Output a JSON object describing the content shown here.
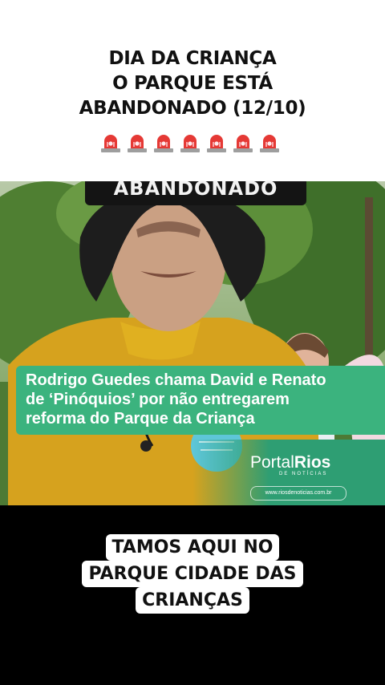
{
  "headline": {
    "lines": [
      "DIA DA CRIANÇA",
      "O PARQUE ESTÁ",
      "ABANDONADO (12/10)"
    ]
  },
  "siren_icons": {
    "count": 7,
    "icon": "rotating-light-icon",
    "color": "#e53935"
  },
  "video": {
    "overlay_text": "ABANDONADO",
    "news_headline": {
      "lines": [
        "Rodrigo Guedes chama David e Renato",
        "de ‘Pinóquios’ por não entregarem",
        "reforma do Parque da Criança"
      ],
      "color": "#3bb37e"
    },
    "logo": {
      "brand_prefix": "Portal",
      "brand_suffix": "Rios",
      "subtitle": "DE NOTÍCIAS"
    },
    "url": "www.riosdenoticias.com.br"
  },
  "caption": {
    "lines": [
      "TAMOS AQUI NO",
      "PARQUE CIDADE DAS",
      "CRIANÇAS"
    ]
  }
}
